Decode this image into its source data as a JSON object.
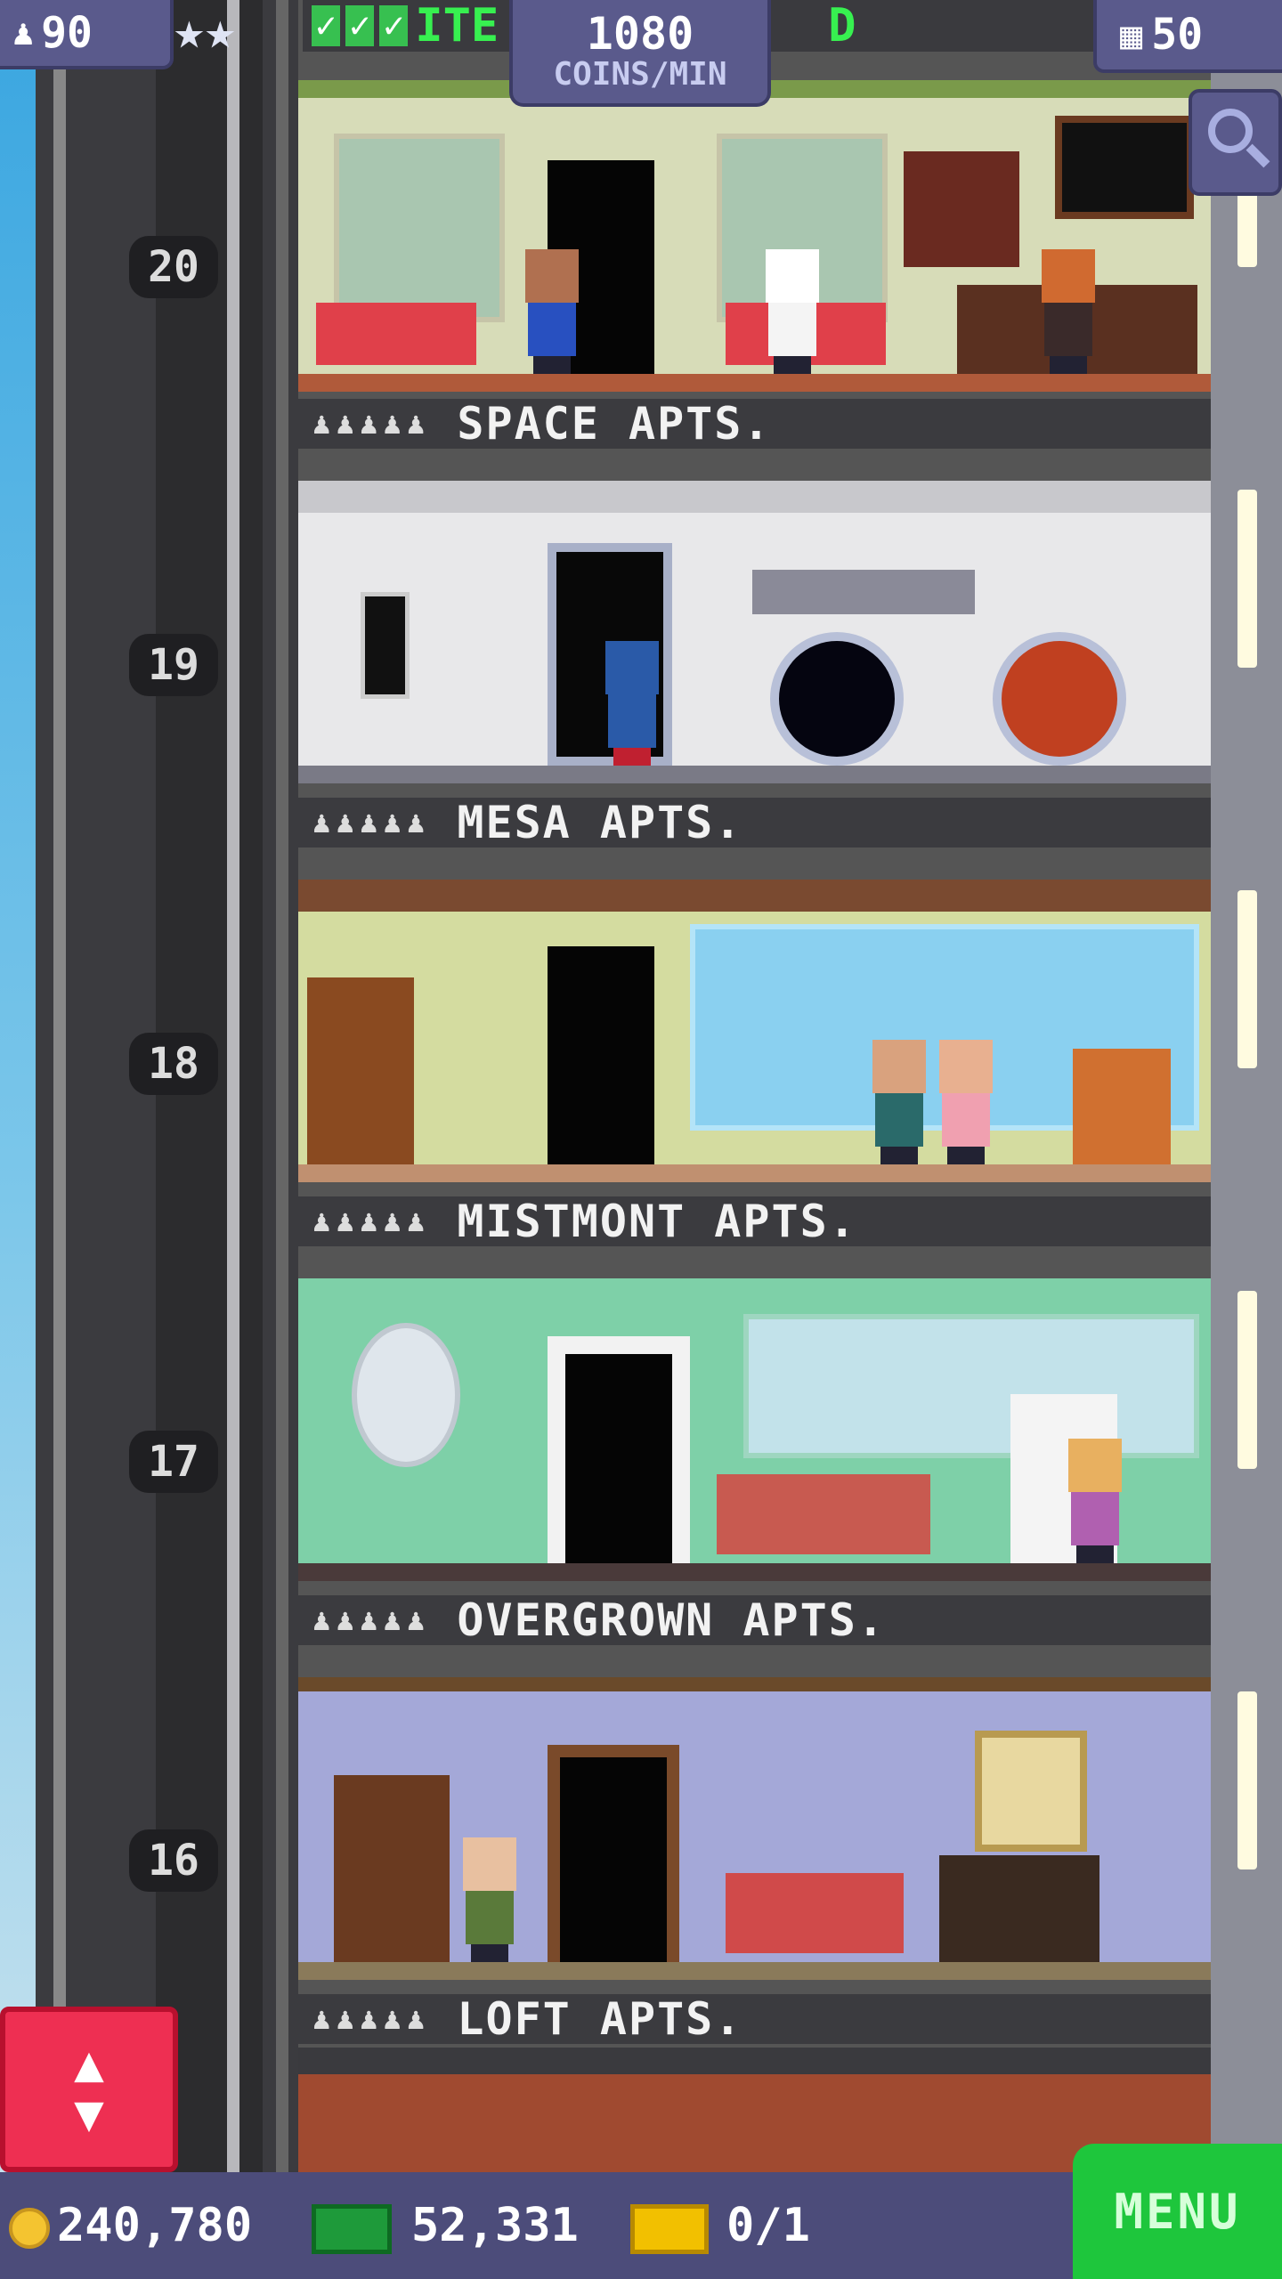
{
  "hud": {
    "population": "90",
    "mission_text": "ITE",
    "mission_tail": "D",
    "coins_rate_value": "1080",
    "coins_rate_unit": "COINS/MIN",
    "floors_count": "50"
  },
  "floors": [
    {
      "number": "20",
      "label": "SPACE APTS."
    },
    {
      "number": "19",
      "label": "MESA APTS."
    },
    {
      "number": "18",
      "label": "MISTMONT APTS."
    },
    {
      "number": "17",
      "label": "OVERGROWN APTS."
    },
    {
      "number": "16",
      "label": "LOFT APTS."
    }
  ],
  "bottom": {
    "coins": "240,780",
    "bux": "52,331",
    "tickets": "0/1",
    "menu_label": "MENU"
  },
  "icons": {
    "population": "person-icon",
    "floors": "building-icon",
    "zoom": "magnifier-icon",
    "elevator": "up-down-arrows-icon",
    "coins": "coin-icon",
    "bux": "banknote-icon",
    "tickets": "ticket-icon"
  },
  "colors": {
    "menu": "#1ec63c",
    "elevator_button": "#ee2f52",
    "hud": "#5a5a8c"
  }
}
